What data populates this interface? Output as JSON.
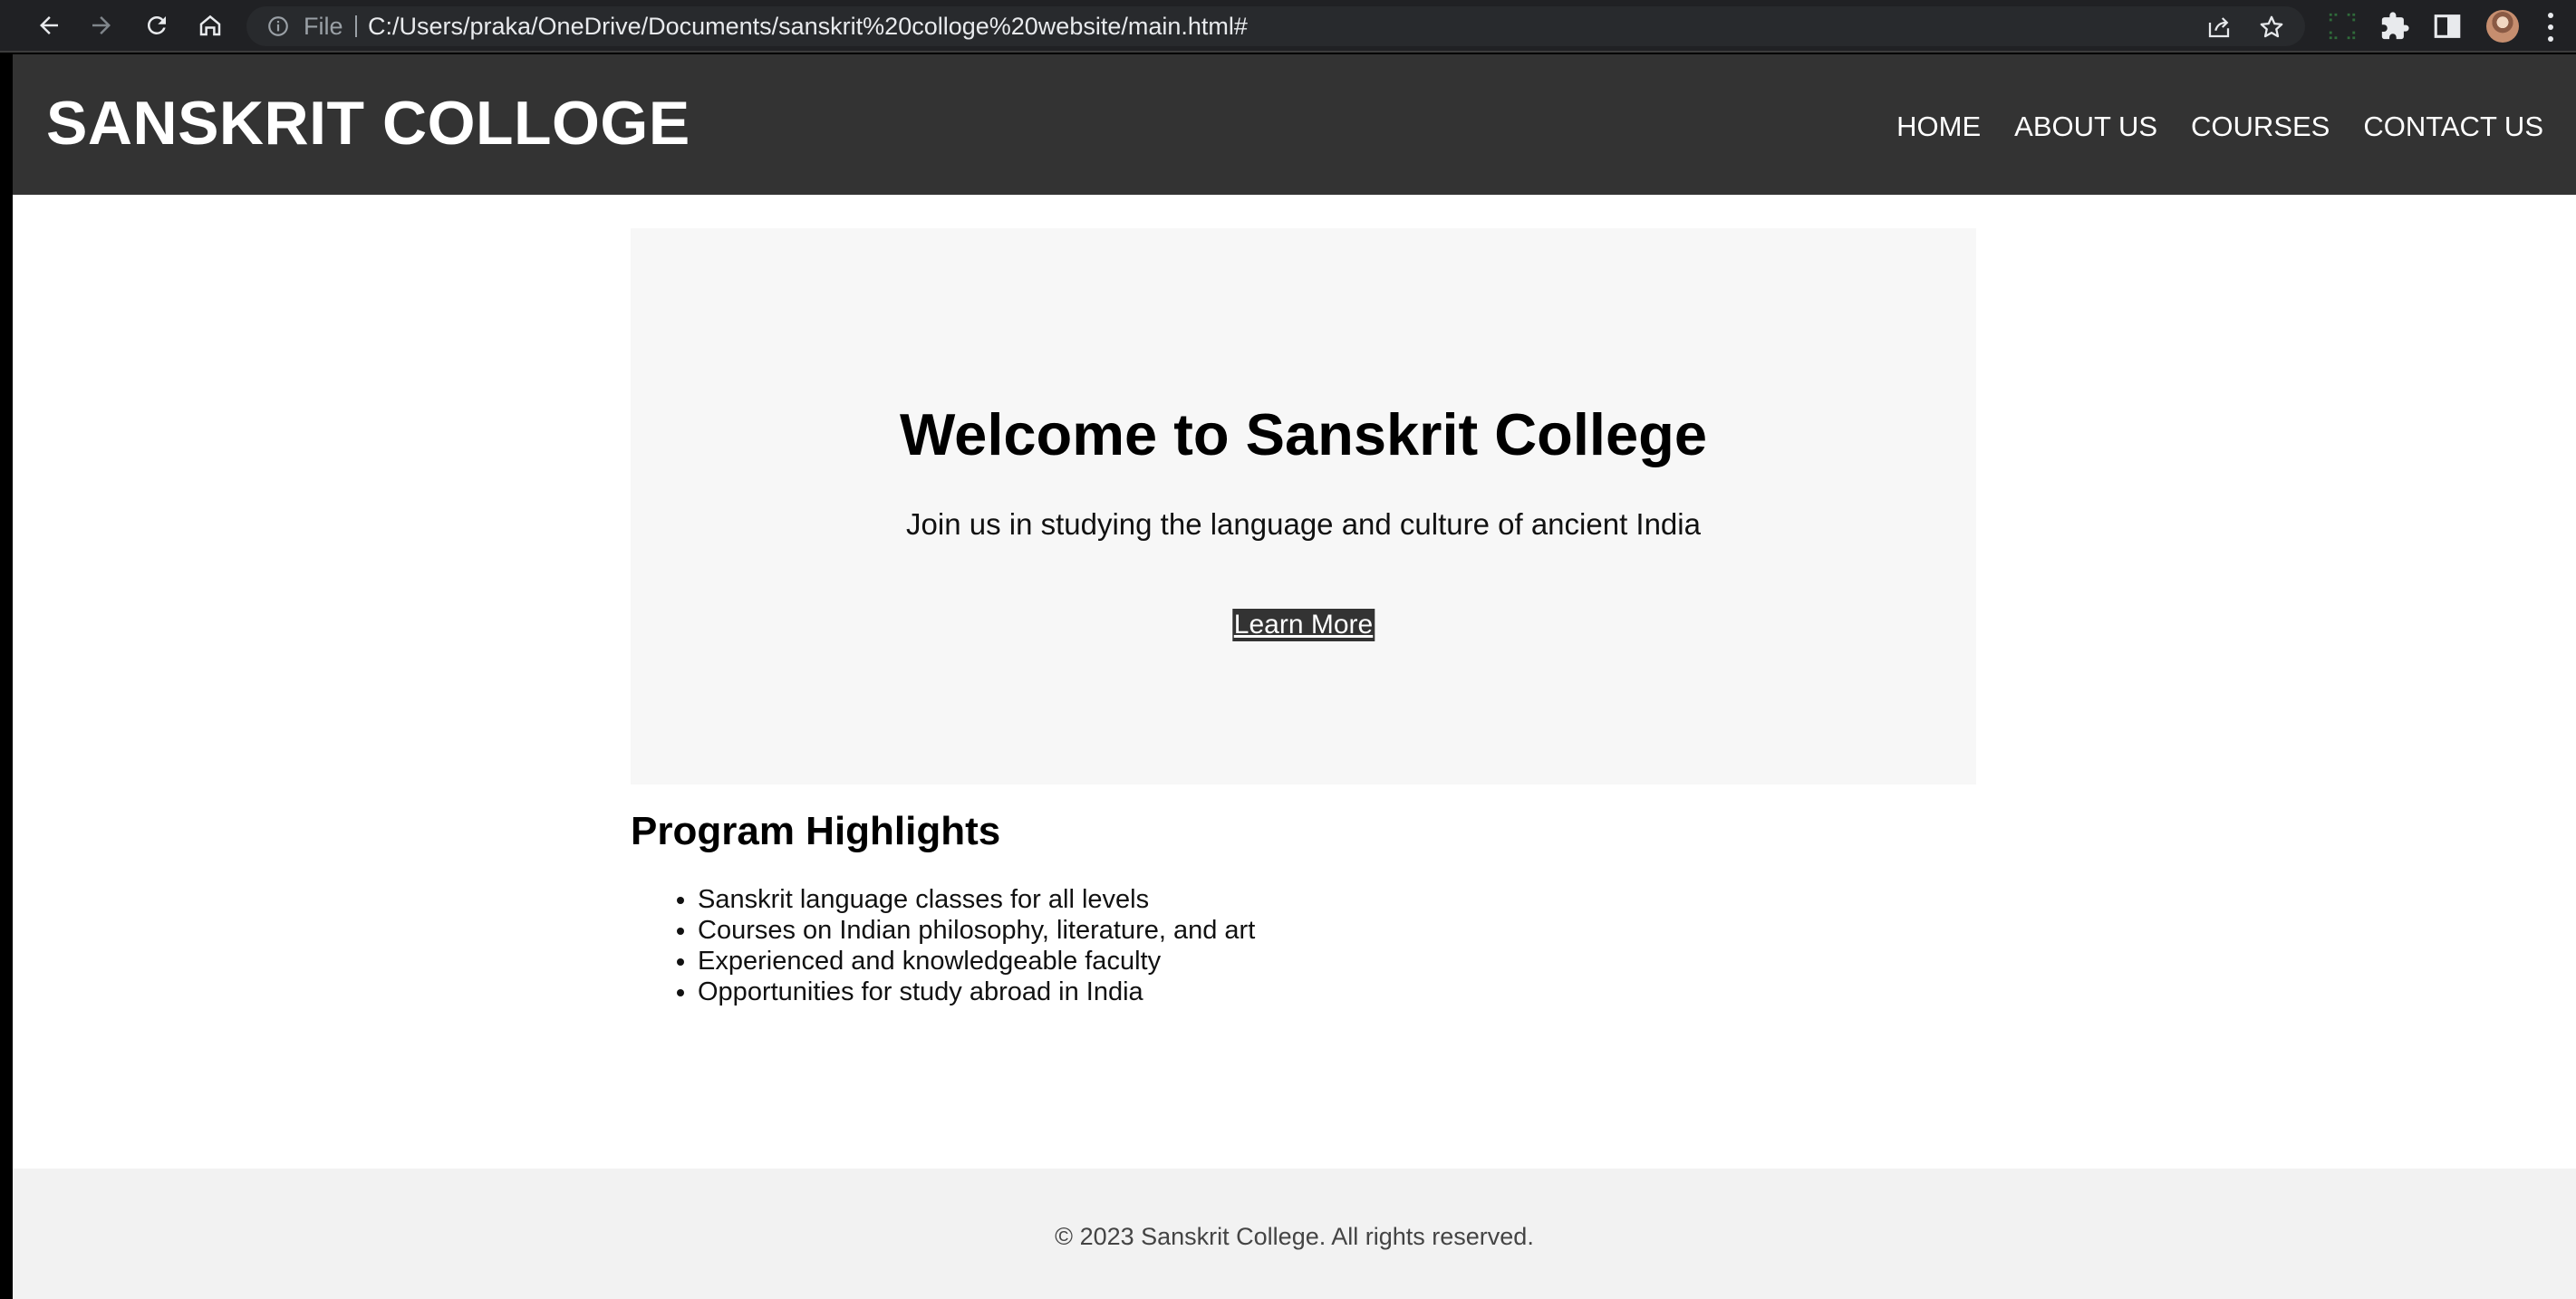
{
  "browser": {
    "scheme_label": "File",
    "url": "C:/Users/praka/OneDrive/Documents/sanskrit%20colloge%20website/main.html#",
    "icons": [
      "back-icon",
      "forward-icon",
      "reload-icon",
      "home-icon",
      "info-icon",
      "share-icon",
      "star-icon",
      "extension-icon",
      "puzzle-icon",
      "side-panel-icon",
      "avatar",
      "kebab-menu-icon"
    ]
  },
  "header": {
    "logo": "SANSKRIT COLLOGE",
    "nav": [
      {
        "label": "HOME"
      },
      {
        "label": "ABOUT US"
      },
      {
        "label": "COURSES"
      },
      {
        "label": "CONTACT US"
      }
    ]
  },
  "hero": {
    "title": "Welcome to Sanskrit College",
    "subtitle": "Join us in studying the language and culture of ancient India",
    "cta_label": "Learn More"
  },
  "highlights": {
    "title": "Program Highlights",
    "items": [
      "Sanskrit language classes for all levels",
      "Courses on Indian philosophy, literature, and art",
      "Experienced and knowledgeable faculty",
      "Opportunities for study abroad in India"
    ]
  },
  "footer": {
    "text": "© 2023 Sanskrit College. All rights reserved."
  },
  "colors": {
    "header_bg": "#333333",
    "hero_bg": "#f7f7f7",
    "footer_bg": "#f2f2f2",
    "chrome_bg": "#202124",
    "omnibox_bg": "#282a2d"
  }
}
